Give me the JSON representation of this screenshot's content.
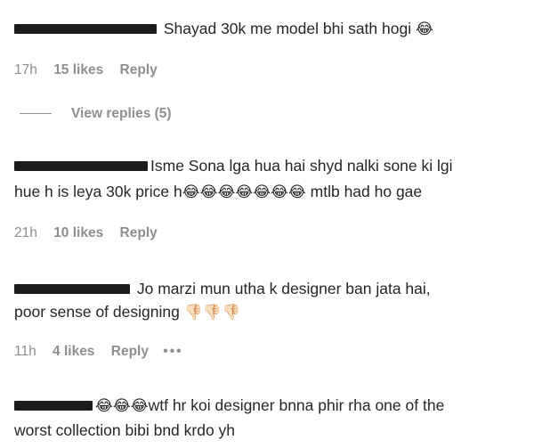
{
  "comments": [
    {
      "text": " Shayad 30k me model bhi sath hogi ",
      "emoji": "😂",
      "time": "17h",
      "likes": "15 likes",
      "reply": "Reply"
    },
    {
      "line1": "Isme Sona lga hua hai shyd nalki sone ki lgi",
      "line2a": "hue h is leya 30k price h",
      "emoji": "😂😂😂😂😂😂😂",
      "line2b": " mtlb had ho gae",
      "time": "21h",
      "likes": "10 likes",
      "reply": "Reply"
    },
    {
      "line1": " Jo marzi mun utha k designer ban jata hai,",
      "line2": "poor sense of designing ",
      "emoji": "👎🏻👎🏻👎🏻",
      "time": "11h",
      "likes": "4 likes",
      "reply": "Reply",
      "more": "•••"
    },
    {
      "emoji": "😂😂😂",
      "line1": "wtf hr koi designer bnna phir rha one of the",
      "line2": "worst collection bibi bnd krdo yh"
    }
  ],
  "view_replies": "View replies (5)"
}
